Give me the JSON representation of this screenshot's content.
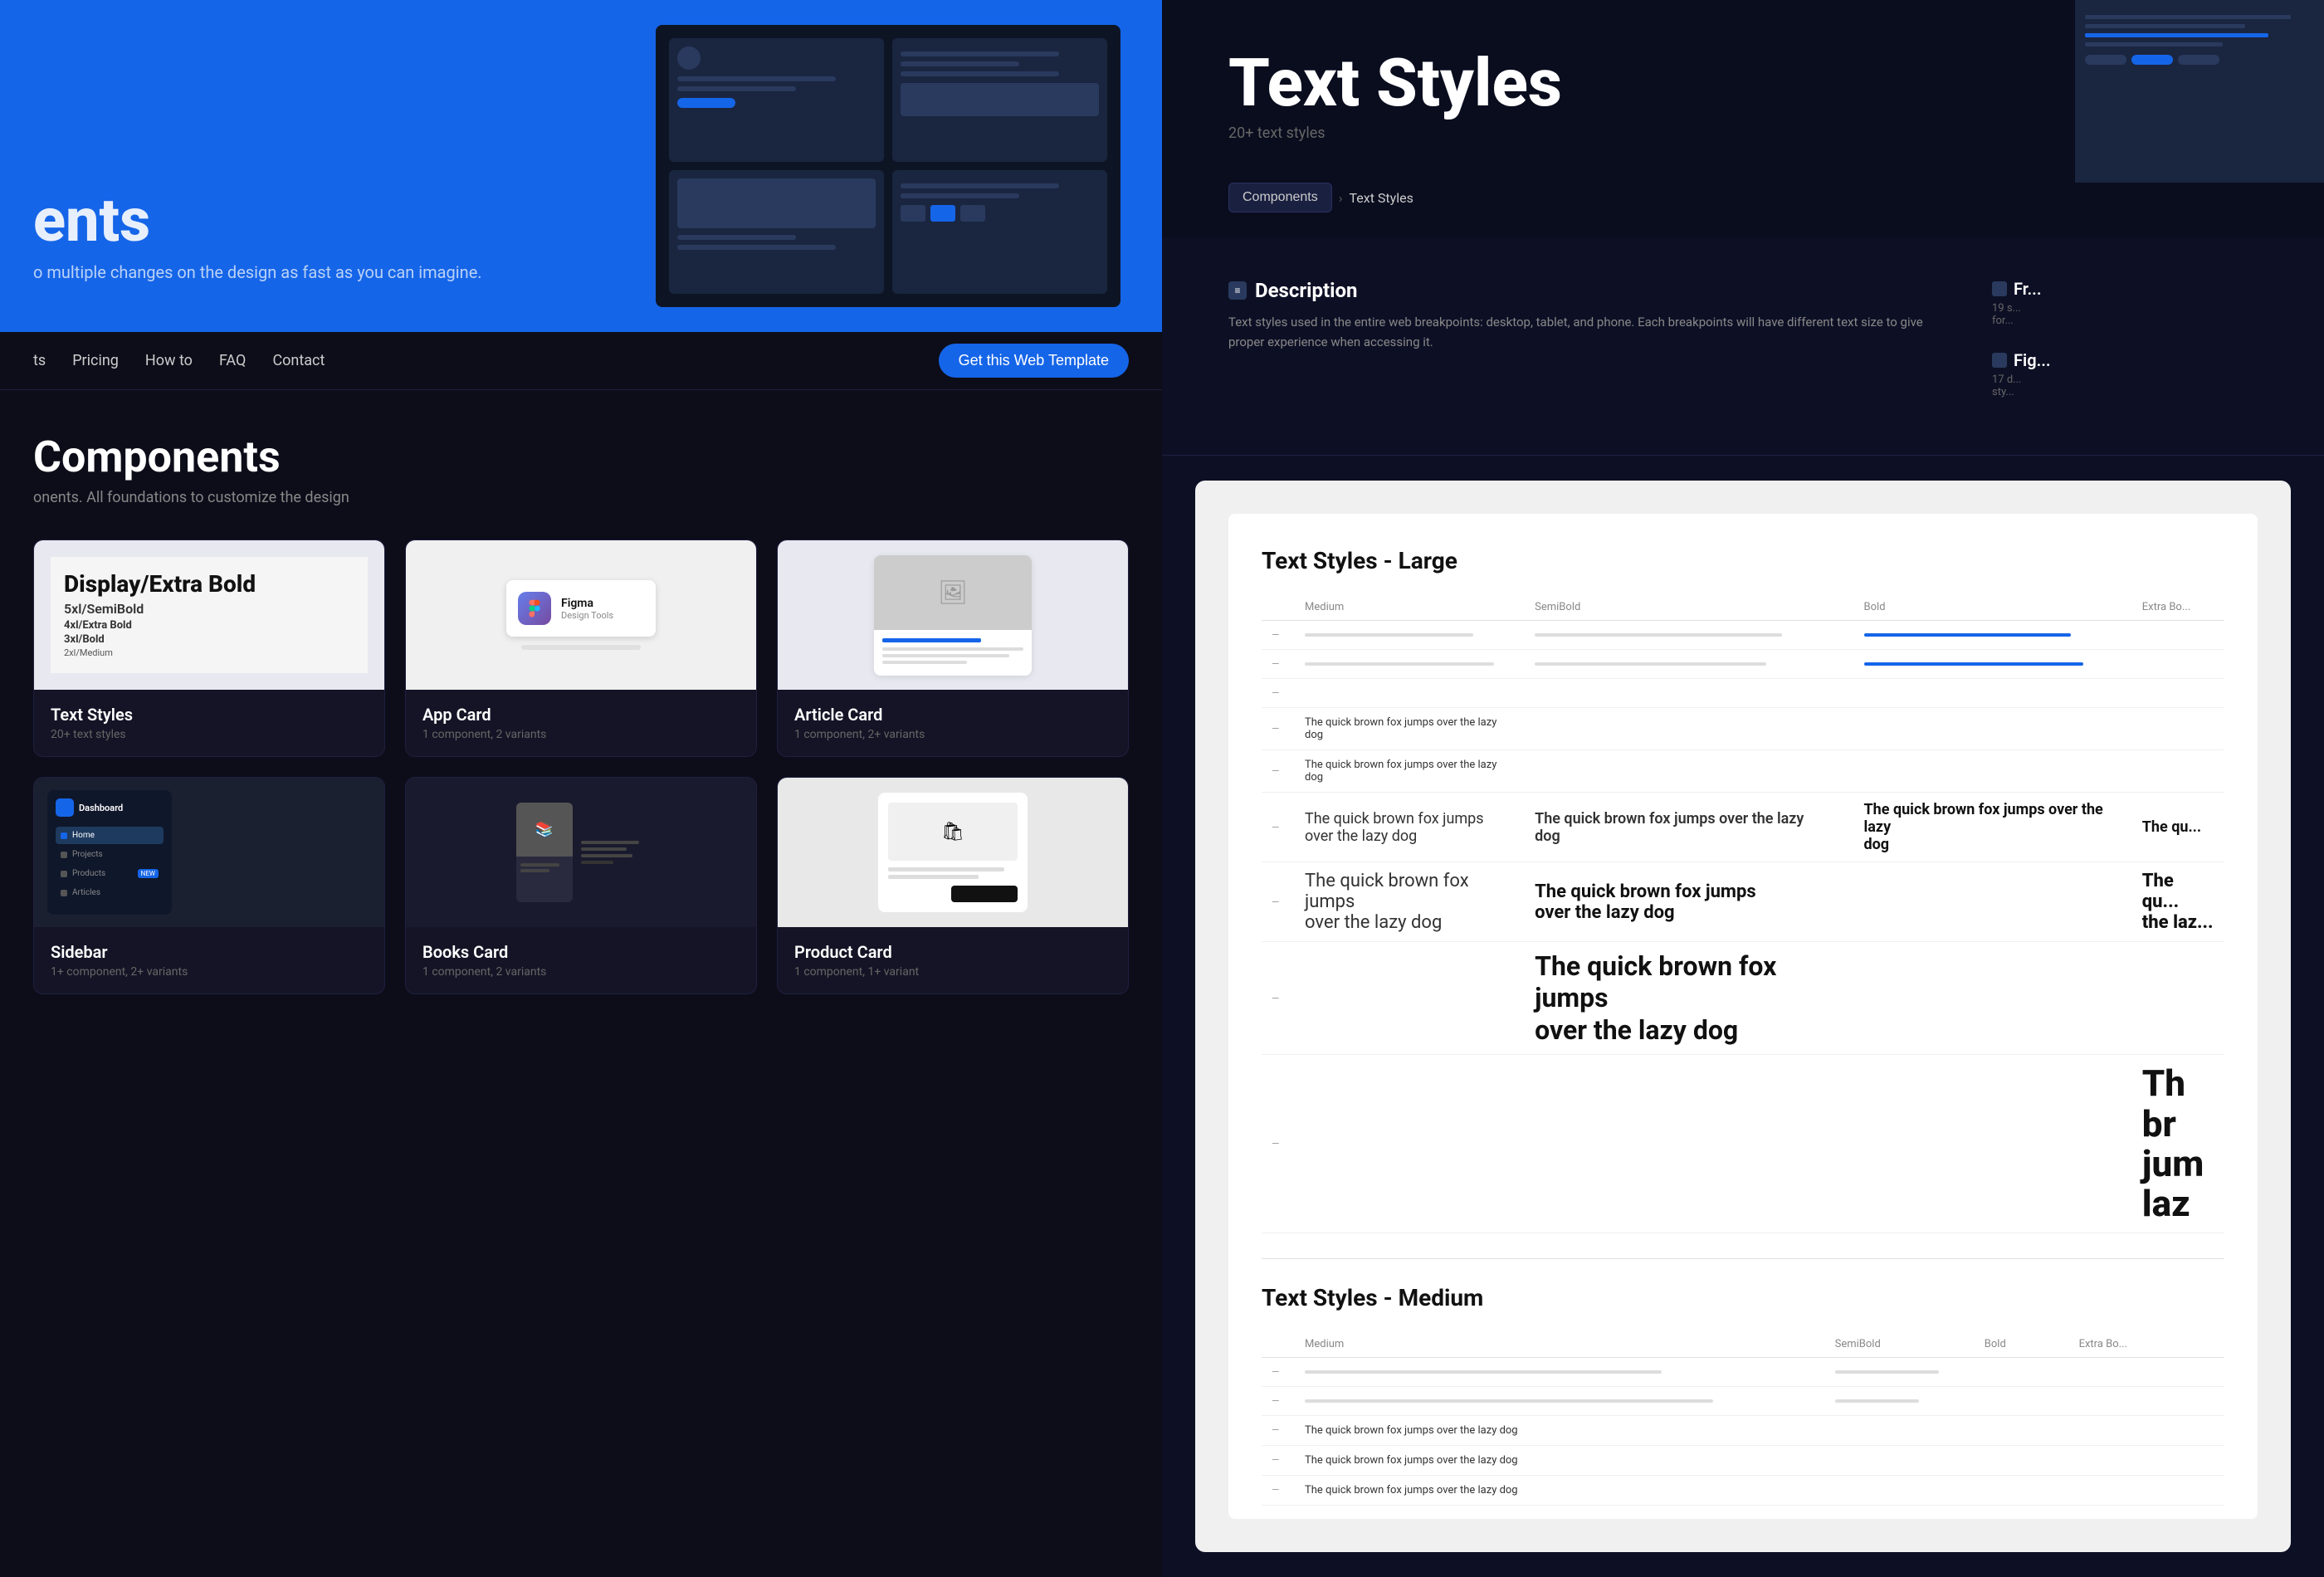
{
  "left": {
    "hero": {
      "title": "ents",
      "subtitle": "o multiple changes on the design as fast as you can imagine."
    },
    "nav": {
      "items": [
        "ts",
        "Pricing",
        "How to",
        "FAQ",
        "Contact"
      ],
      "cta": "Get this Web Template"
    },
    "components_section": {
      "title": "Components",
      "subtitle": "onents. All foundations to customize the design",
      "cards": [
        {
          "name": "Text Styles",
          "meta": "20+ text styles",
          "type": "text-styles"
        },
        {
          "name": "App Card",
          "meta": "1 component, 2 variants",
          "type": "app-card"
        },
        {
          "name": "Article Card",
          "meta": "1 component, 2+ variants",
          "type": "article-card"
        },
        {
          "name": "Sidebar",
          "meta": "1+ component, 2+ variants",
          "type": "sidebar"
        },
        {
          "name": "Books Card",
          "meta": "1 component, 2 variants",
          "type": "books-card"
        },
        {
          "name": "Product Card",
          "meta": "1 component, 1+ variant",
          "type": "product-card"
        }
      ]
    }
  },
  "right": {
    "header": {
      "title": "Text Styles",
      "subtitle": "20+ text styles"
    },
    "breadcrumb": {
      "parent": "Components",
      "current": "Text Styles"
    },
    "description": {
      "heading": "Description",
      "text": "Text styles used in the entire web breakpoints: desktop, tablet, and phone. Each breakpoints will have different text size to give proper experience when accessing it.",
      "right_items": [
        {
          "label": "Fr...",
          "count": "19 s...",
          "detail": "for..."
        },
        {
          "label": "Fig...",
          "count": "17 d...",
          "detail": "sty..."
        }
      ]
    },
    "preview": {
      "large_section": "Text Styles - Large",
      "medium_section": "Text Styles - Medium",
      "columns": [
        "Medium",
        "SemiBold",
        "Bold",
        "Extra Bo..."
      ],
      "rows_large": [
        {
          "label": "—",
          "med": "",
          "semi": "",
          "bold": "",
          "extra": ""
        },
        {
          "label": "—",
          "med": "",
          "semi": "",
          "bold": "",
          "extra": ""
        },
        {
          "label": "—",
          "med": "",
          "semi": "",
          "bold": "",
          "extra": ""
        },
        {
          "label": "—",
          "med": "The quick brown fox jumps over the lazy dog",
          "semi": "",
          "bold": "",
          "extra": ""
        },
        {
          "label": "—",
          "med": "The quick brown fox jumps over the lazy dog",
          "semi": "",
          "bold": "",
          "extra": ""
        },
        {
          "label": "—",
          "med": "The quick brown fox jumps\nover the lazy dog",
          "semi": "The quick brown fox jumps over the lazy\ndog",
          "bold": "The quick brown fox jumps over the lazy\ndog",
          "extra": "The qu..."
        },
        {
          "label": "—",
          "med": "The quick brown fox jumps\nover the lazy dog",
          "semi": "The quick brown fox jumps\nover the lazy dog",
          "bold": "",
          "extra": "The qu...\nthe laz..."
        },
        {
          "label": "—",
          "med": "",
          "semi": "",
          "bold": "",
          "extra": ""
        },
        {
          "label": "—",
          "med": "",
          "semi": "The quick brown fox jumps\nover the lazy dog",
          "bold": "",
          "extra": ""
        }
      ]
    }
  }
}
